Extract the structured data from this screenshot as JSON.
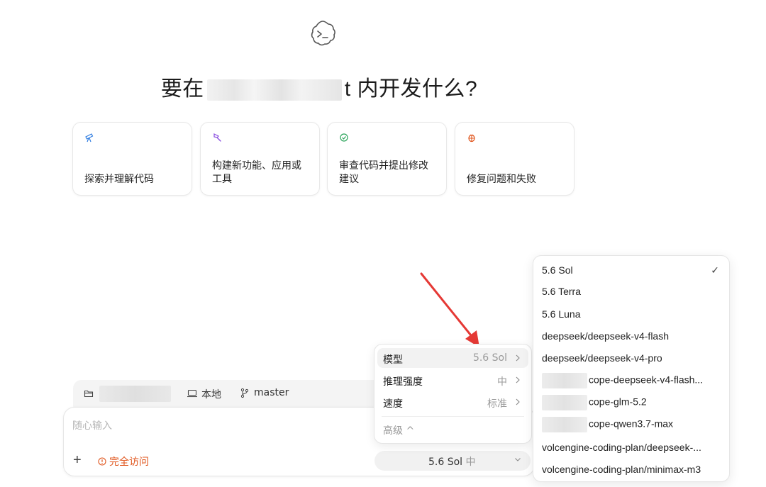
{
  "headline": {
    "prefix": "要在",
    "suffix": "t 内开发什么?"
  },
  "suggestions": [
    {
      "icon": "telescope-icon",
      "label": "探索并理解代码"
    },
    {
      "icon": "hammer-icon",
      "label": "构建新功能、应用或工具"
    },
    {
      "icon": "review-icon",
      "label": "审查代码并提出修改建议"
    },
    {
      "icon": "bug-icon",
      "label": "修复问题和失败"
    }
  ],
  "toolbar": {
    "location_label": "本地",
    "branch_label": "master"
  },
  "input": {
    "placeholder": "随心输入",
    "access_label": "完全访问"
  },
  "model_button": {
    "label": "5.6 Sol",
    "effort": "中"
  },
  "settings_menu": {
    "rows": [
      {
        "key": "模型",
        "value": "5.6 Sol"
      },
      {
        "key": "推理强度",
        "value": "中"
      },
      {
        "key": "速度",
        "value": "标准"
      }
    ],
    "advanced_label": "高级 ^"
  },
  "model_menu": {
    "options": [
      {
        "label": "5.6 Sol",
        "selected": true
      },
      {
        "label": "5.6 Terra"
      },
      {
        "label": "5.6 Luna"
      },
      {
        "label": "deepseek/deepseek-v4-flash"
      },
      {
        "label": "deepseek/deepseek-v4-pro"
      },
      {
        "label": "cope-deepseek-v4-flash..."
      },
      {
        "label": "cope-glm-5.2"
      },
      {
        "label": "cope-qwen3.7-max"
      },
      {
        "label": "volcengine-coding-plan/deepseek-..."
      },
      {
        "label": "volcengine-coding-plan/minimax-m3"
      }
    ],
    "check_glyph": "✓"
  },
  "colors": {
    "accent_orange": "#e0541b",
    "annotation_arrow": "#e53935"
  }
}
